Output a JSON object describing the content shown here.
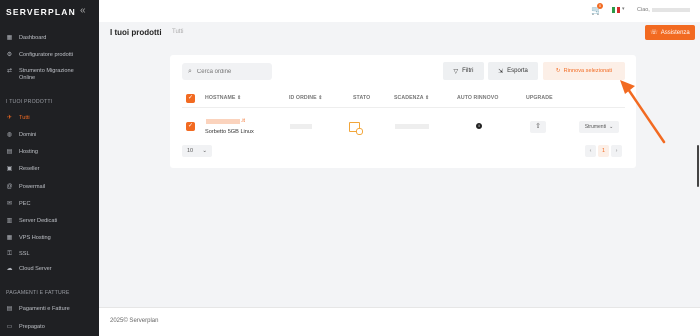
{
  "brand": {
    "name_a": "SERVER",
    "name_b": "PLAN",
    "collapse_icon": "double-chevron-left"
  },
  "sidebar": {
    "items_top": [
      {
        "label": "Dashboard",
        "icon": "grid-icon"
      },
      {
        "label": "Configuratore prodotti",
        "icon": "sliders-icon"
      },
      {
        "label": "Strumento Migrazione Online",
        "icon": "migration-icon"
      }
    ],
    "section_products": "I TUOI PRODOTTI",
    "products": [
      {
        "label": "Tutti",
        "icon": "rocket-icon",
        "active": true
      },
      {
        "label": "Domini",
        "icon": "globe-icon"
      },
      {
        "label": "Hosting",
        "icon": "server-icon"
      },
      {
        "label": "Reseller",
        "icon": "reseller-icon"
      },
      {
        "label": "Powermail",
        "icon": "at-icon"
      },
      {
        "label": "PEC",
        "icon": "mail-icon"
      },
      {
        "label": "Server Dedicati",
        "icon": "rack-icon"
      },
      {
        "label": "VPS Hosting",
        "icon": "vps-icon"
      },
      {
        "label": "SSL",
        "icon": "lock-icon"
      },
      {
        "label": "Cloud Server",
        "icon": "cloud-icon"
      }
    ],
    "section_payments": "PAGAMENTI E FATTURE",
    "payments": [
      {
        "label": "Pagamenti e Fatture",
        "icon": "invoice-icon"
      },
      {
        "label": "Prepagato",
        "icon": "wallet-icon"
      }
    ]
  },
  "topbar": {
    "cart_count": "0",
    "greeting": "Ciao,"
  },
  "header": {
    "title": "I tuoi prodotti",
    "crumb": "Tutti",
    "assist_label": "Assistenza"
  },
  "toolbar": {
    "search_placeholder": "Cerca ordine",
    "filter_label": "Filtri",
    "export_label": "Esporta",
    "renew_label": "Rinnova selezionati"
  },
  "table": {
    "headers": {
      "hostname": "HOSTNAME",
      "order_id": "ID ORDINE",
      "status": "STATO",
      "expiry": "SCADENZA",
      "auto_renew": "AUTO RINNOVO",
      "upgrade": "UPGRADE"
    },
    "rows": [
      {
        "host_suffix": ".it",
        "product": "Sorbetto 5GB Linux",
        "actions_label": "Strumenti"
      }
    ]
  },
  "pagination": {
    "per_page": "10",
    "prev": "‹",
    "current": "1",
    "next": "›"
  },
  "footer": {
    "text": "2025© Serverplan"
  },
  "colors": {
    "accent": "#f26a21",
    "sidebar_bg": "#1f2023",
    "page_bg": "#f3f4f6"
  }
}
